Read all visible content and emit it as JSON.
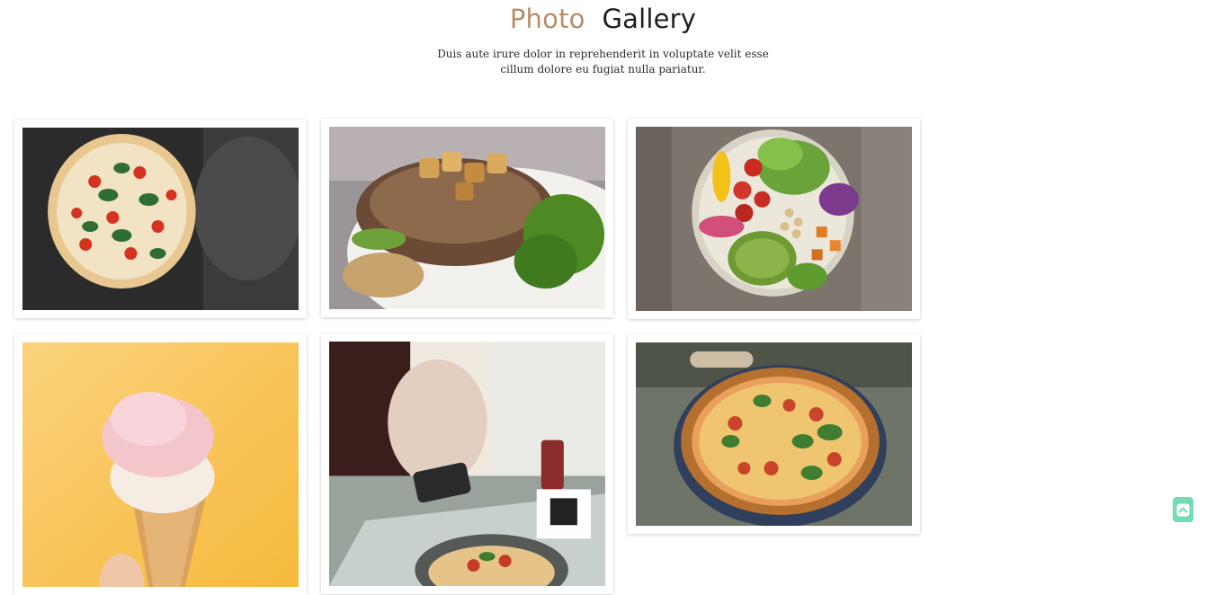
{
  "header": {
    "title_accent": "Photo",
    "title_rest": "Gallery",
    "subtitle": "Duis aute irure dolor in reprehenderit in voluptate velit esse cillum dolore eu fugiat nulla pariatur."
  },
  "gallery": {
    "items": [
      {
        "subject": "pizza-margherita-dark-background"
      },
      {
        "subject": "grilled-steak-with-potatoes"
      },
      {
        "subject": "salad-bowl"
      },
      {
        "subject": "ice-cream-cone-yellow-background"
      },
      {
        "subject": "person-eating-pizza-at-table"
      },
      {
        "subject": "pizza-on-wooden-table"
      }
    ]
  },
  "colors": {
    "accent": "#b78d6a",
    "scroll_button": "#74dcb1"
  },
  "icons": {
    "scroll_top": "chevron-up-icon"
  }
}
